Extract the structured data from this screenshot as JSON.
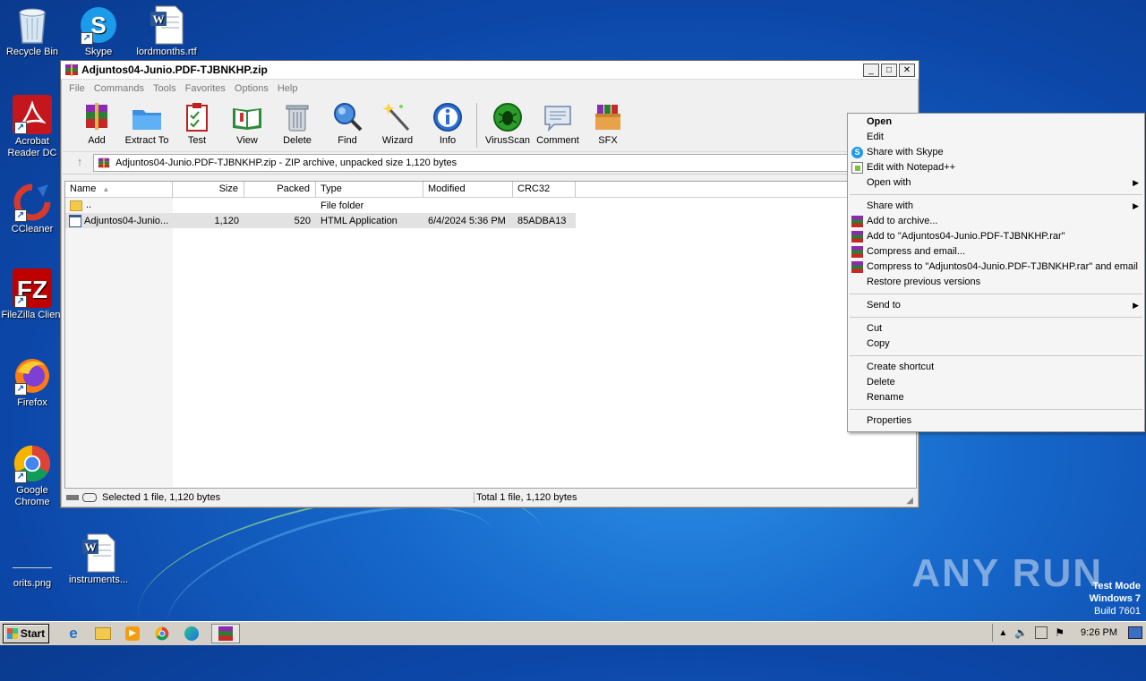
{
  "desktop": {
    "icons": [
      {
        "label": "Recycle Bin"
      },
      {
        "label": "Skype"
      },
      {
        "label": "lordmonths.rtf"
      },
      {
        "label": "Acrobat Reader DC"
      },
      {
        "label": "CCleaner"
      },
      {
        "label": "FileZilla Client"
      },
      {
        "label": "Firefox"
      },
      {
        "label": "Google Chrome"
      },
      {
        "label": "orits.png"
      },
      {
        "label": "instruments..."
      }
    ],
    "watermark": "ANY RUN",
    "testmode": {
      "line1": "Test Mode",
      "line2": "Windows 7",
      "line3": "Build 7601"
    }
  },
  "window": {
    "title": "Adjuntos04-Junio.PDF-TJBNKHP.zip",
    "menu": [
      "File",
      "Commands",
      "Tools",
      "Favorites",
      "Options",
      "Help"
    ],
    "toolbar": [
      {
        "label": "Add",
        "icon": "add-archive-icon"
      },
      {
        "label": "Extract To",
        "icon": "extract-folder-icon"
      },
      {
        "label": "Test",
        "icon": "test-checklist-icon"
      },
      {
        "label": "View",
        "icon": "view-book-icon"
      },
      {
        "label": "Delete",
        "icon": "trash-icon"
      },
      {
        "label": "Find",
        "icon": "magnifier-icon"
      },
      {
        "label": "Wizard",
        "icon": "wand-icon"
      },
      {
        "label": "Info",
        "icon": "info-icon"
      },
      {
        "label": "VirusScan",
        "icon": "bug-icon"
      },
      {
        "label": "Comment",
        "icon": "comment-icon"
      },
      {
        "label": "SFX",
        "icon": "sfx-box-icon"
      }
    ],
    "address": "Adjuntos04-Junio.PDF-TJBNKHP.zip - ZIP archive, unpacked size 1,120 bytes",
    "columns": [
      "Name",
      "Size",
      "Packed",
      "Type",
      "Modified",
      "CRC32"
    ],
    "rows": [
      {
        "name": "..",
        "size": "",
        "packed": "",
        "type": "File folder",
        "modified": "",
        "crc": ""
      },
      {
        "name": "Adjuntos04-Junio...",
        "size": "1,120",
        "packed": "520",
        "type": "HTML Application",
        "modified": "6/4/2024 5:36 PM",
        "crc": "85ADBA13"
      }
    ],
    "status_left": "Selected 1 file, 1,120 bytes",
    "status_right": "Total 1 file, 1,120 bytes"
  },
  "context_menu": {
    "items": [
      {
        "label": "Open",
        "bold": true
      },
      {
        "label": "Edit"
      },
      {
        "label": "Share with Skype",
        "icon": "skype-icon"
      },
      {
        "label": "Edit with Notepad++",
        "icon": "notepad-plus-icon"
      },
      {
        "label": "Open with",
        "submenu": true
      },
      {
        "label": "Share with",
        "submenu": true
      },
      {
        "label": "Add to archive...",
        "icon": "winrar-icon"
      },
      {
        "label": "Add to \"Adjuntos04-Junio.PDF-TJBNKHP.rar\"",
        "icon": "winrar-icon"
      },
      {
        "label": "Compress and email...",
        "icon": "winrar-icon"
      },
      {
        "label": "Compress to \"Adjuntos04-Junio.PDF-TJBNKHP.rar\" and email",
        "icon": "winrar-icon"
      },
      {
        "label": "Restore previous versions"
      },
      {
        "label": "Send to",
        "submenu": true
      },
      {
        "label": "Cut"
      },
      {
        "label": "Copy"
      },
      {
        "label": "Create shortcut"
      },
      {
        "label": "Delete"
      },
      {
        "label": "Rename"
      },
      {
        "label": "Properties"
      }
    ]
  },
  "taskbar": {
    "start_label": "Start",
    "clock": "9:26 PM"
  }
}
